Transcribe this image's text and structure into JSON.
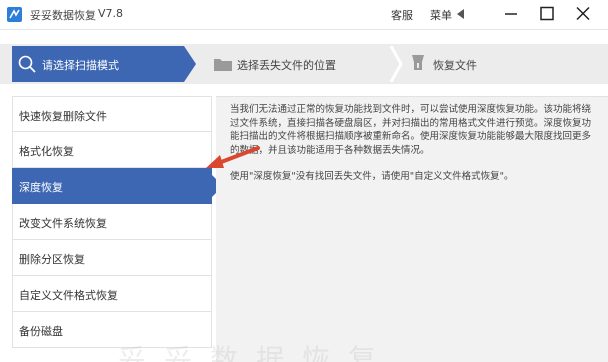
{
  "titlebar": {
    "app_title": "妥妥数据恢复",
    "version": "V7.8",
    "service_label": "客服",
    "menu_label": "菜单"
  },
  "steps": [
    {
      "label": "请选择扫描模式",
      "icon": "search-icon",
      "active": true
    },
    {
      "label": "选择丢失文件的位置",
      "icon": "folder-icon",
      "active": false
    },
    {
      "label": "恢复文件",
      "icon": "restore-icon",
      "active": false
    }
  ],
  "menu": {
    "items": [
      {
        "label": "快速恢复删除文件",
        "active": false
      },
      {
        "label": "格式化恢复",
        "active": false
      },
      {
        "label": "深度恢复",
        "active": true
      },
      {
        "label": "改变文件系统恢复",
        "active": false
      },
      {
        "label": "删除分区恢复",
        "active": false
      },
      {
        "label": "自定义文件格式恢复",
        "active": false
      },
      {
        "label": "备份磁盘",
        "active": false
      }
    ]
  },
  "description": {
    "paragraph1": "当我们无法通过正常的恢复功能找到文件时，可以尝试使用深度恢复功能。该功能将绕过文件系统，直接扫描各硬盘扇区，并对扫描出的常用格式文件进行预览。深度恢复功能扫描出的文件将根据扫描顺序被重新命名。使用深度恢复功能能够最大限度找回更多的数据，并且该功能适用于各种数据丢失情况。",
    "paragraph2": "使用\"深度恢复\"没有找回丢失文件，请使用\"自定义文件格式恢复\"。"
  },
  "watermark": "妥妥数据恢复",
  "colors": {
    "accent": "#3d67b3",
    "steps_bg": "#ececec",
    "panel_bg": "#f2f2f2",
    "annotation": "#d9472f"
  }
}
